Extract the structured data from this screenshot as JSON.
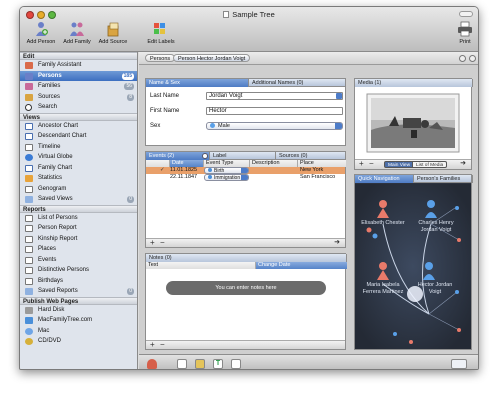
{
  "window": {
    "title": "Sample Tree"
  },
  "toolbar": {
    "add_person": "Add Person",
    "add_family": "Add Family",
    "add_source": "Add Source",
    "edit_labels": "Edit Labels",
    "print": "Print"
  },
  "sidebar": {
    "edit": {
      "header": "Edit",
      "items": [
        {
          "label": "Family Assistant",
          "count": ""
        },
        {
          "label": "Persons",
          "count": "185"
        },
        {
          "label": "Families",
          "count": "56"
        },
        {
          "label": "Sources",
          "count": "8"
        },
        {
          "label": "Search",
          "count": ""
        }
      ]
    },
    "views": {
      "header": "Views",
      "items": [
        {
          "label": "Ancestor Chart"
        },
        {
          "label": "Descendant Chart"
        },
        {
          "label": "Timeline"
        },
        {
          "label": "Virtual Globe"
        },
        {
          "label": "Family Chart"
        },
        {
          "label": "Statistics"
        },
        {
          "label": "Genogram"
        },
        {
          "label": "Saved Views",
          "count": "0"
        }
      ]
    },
    "reports": {
      "header": "Reports",
      "items": [
        {
          "label": "List of Persons"
        },
        {
          "label": "Person Report"
        },
        {
          "label": "Kinship Report"
        },
        {
          "label": "Places"
        },
        {
          "label": "Events"
        },
        {
          "label": "Distinctive Persons"
        },
        {
          "label": "Birthdays"
        },
        {
          "label": "Saved Reports",
          "count": "0"
        }
      ]
    },
    "publish": {
      "header": "Publish Web Pages",
      "items": [
        {
          "label": "Hard Disk"
        },
        {
          "label": "MacFamilyTree.com"
        },
        {
          "label": "Mac"
        },
        {
          "label": "CD/DVD"
        }
      ]
    }
  },
  "breadcrumb": {
    "root": "Persons",
    "current": "Person Hector Jordan Voigt"
  },
  "person": {
    "tabs": [
      "Name & Sex",
      "Additional Names (0)"
    ],
    "last_name_label": "Last Name",
    "last_name": "Jordan Voigt",
    "first_name_label": "First Name",
    "first_name": "Hector",
    "sex_label": "Sex",
    "sex": "Male"
  },
  "events": {
    "tabs": [
      "Events (2)",
      "Label",
      "Sources (0)"
    ],
    "columns": [
      "Date",
      "Event Type",
      "Description",
      "Place"
    ],
    "rows": [
      {
        "date": "11.01.1825",
        "type": "Birth",
        "description": "",
        "place": "New York"
      },
      {
        "date": "22.11.1847",
        "type": "Immigration",
        "description": "",
        "place": "San Francisco"
      }
    ]
  },
  "notes": {
    "tab": "Notes (0)",
    "columns": [
      "Text",
      "Change Date"
    ],
    "placeholder": "You can enter notes here"
  },
  "media": {
    "tab": "Media (1)",
    "buttons": [
      "Main View",
      "List of Media"
    ]
  },
  "navigation": {
    "tabs": [
      "Quick Navigation",
      "Person's Families"
    ],
    "persons": [
      {
        "name": "Elisabeth Chester"
      },
      {
        "name": "Charles Henry Jordan Voigt"
      },
      {
        "name": "Maria Isabela Ferrera Martinez"
      },
      {
        "name": "Hector Jordan Voigt"
      }
    ]
  },
  "colors": {
    "accent": "#4e7cc4",
    "selection": "#3d6fc0",
    "nav_bg": "#2d3340",
    "male": "#5aa0e8",
    "female": "#e87a6a",
    "highlight_bar": "#e9a06a"
  }
}
